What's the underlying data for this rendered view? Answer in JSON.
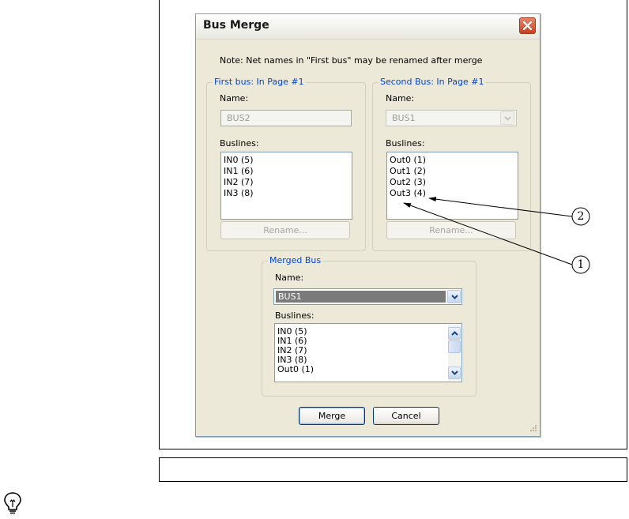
{
  "dialog": {
    "title": "Bus Merge",
    "note": "Note: Net names in \"First bus\" may be renamed after merge"
  },
  "first_bus": {
    "group_title": "First bus: In Page #1",
    "name_label": "Name:",
    "name_value": "BUS2",
    "buslines_label": "Buslines:",
    "buslines": [
      "IN0 (5)",
      "IN1 (6)",
      "IN2 (7)",
      "IN3 (8)"
    ],
    "rename_label": "Rename..."
  },
  "second_bus": {
    "group_title": "Second Bus: In Page #1",
    "name_label": "Name:",
    "name_value": "BUS1",
    "buslines_label": "Buslines:",
    "buslines": [
      "Out0 (1)",
      "Out1 (2)",
      "Out2 (3)",
      "Out3 (4)"
    ],
    "rename_label": "Rename..."
  },
  "merged_bus": {
    "group_title": "Merged Bus",
    "name_label": "Name:",
    "name_value": "BUS1",
    "buslines_label": "Buslines:",
    "buslines": [
      "IN0 (5)",
      "IN1 (6)",
      "IN2 (7)",
      "IN3 (8)",
      "Out0 (1)"
    ]
  },
  "buttons": {
    "merge": "Merge",
    "cancel": "Cancel"
  },
  "callouts": [
    "1",
    "2"
  ],
  "icons": {
    "close": "close-icon",
    "dropdown": "chevron-down-icon",
    "tip": "lightbulb-icon"
  },
  "colors": {
    "dialog_bg": "#ece9d8",
    "group_title": "#0046d5",
    "close_button": "#d4553a"
  }
}
